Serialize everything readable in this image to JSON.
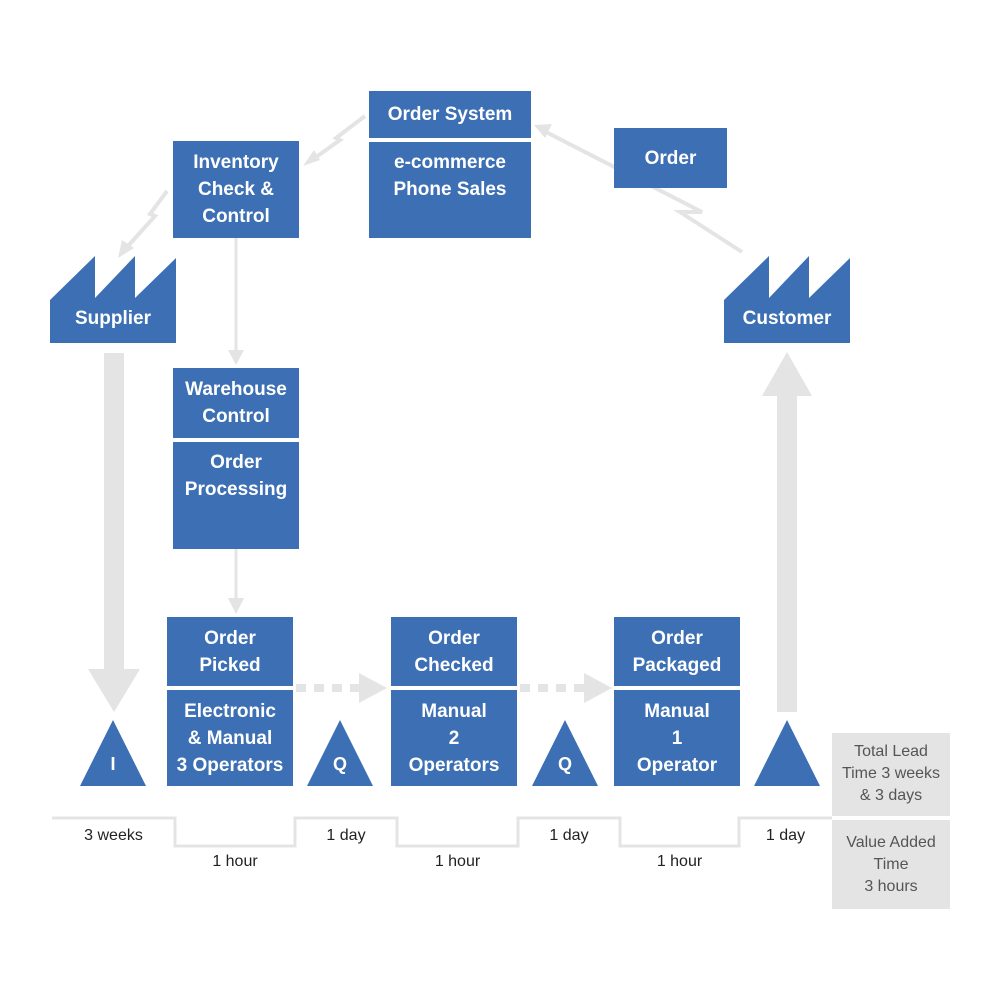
{
  "diagram": {
    "type": "value-stream-map",
    "colors": {
      "process": "#3c6fb4",
      "arrow": "#e4e4e4",
      "summary": "#e4e4e4",
      "text_light": "#ffffff",
      "text_dark": "#222222"
    },
    "order_system": {
      "title": "Order System",
      "details": [
        "e-commerce",
        "Phone Sales"
      ]
    },
    "inventory": {
      "lines": [
        "Inventory",
        "Check &",
        "Control"
      ]
    },
    "order_note": {
      "label": "Order"
    },
    "supplier": {
      "label": "Supplier",
      "icon": "factory-icon"
    },
    "customer": {
      "label": "Customer",
      "icon": "factory-icon"
    },
    "warehouse": {
      "title": [
        "Warehouse",
        "Control"
      ],
      "details": [
        "Order",
        "Processing"
      ]
    },
    "processes": [
      {
        "title": [
          "Order",
          "Picked"
        ],
        "details": [
          "Electronic",
          "& Manual",
          "3 Operators"
        ]
      },
      {
        "title": [
          "Order",
          "Checked"
        ],
        "details": [
          "Manual",
          "2",
          "Operators"
        ]
      },
      {
        "title": [
          "Order",
          "Packaged"
        ],
        "details": [
          "Manual",
          "1",
          "Operator"
        ]
      }
    ],
    "inventories": [
      {
        "label": "I"
      },
      {
        "label": "Q"
      },
      {
        "label": "Q"
      },
      {
        "label": ""
      }
    ],
    "timeline": {
      "wait_times": [
        "3 weeks",
        "1 day",
        "1 day",
        "1 day"
      ],
      "process_times": [
        "1 hour",
        "1 hour",
        "1 hour"
      ]
    },
    "summary": {
      "lead_time": [
        "Total Lead",
        "Time 3 weeks",
        "& 3 days"
      ],
      "value_added": [
        "Value Added",
        "Time",
        "3 hours"
      ]
    }
  }
}
